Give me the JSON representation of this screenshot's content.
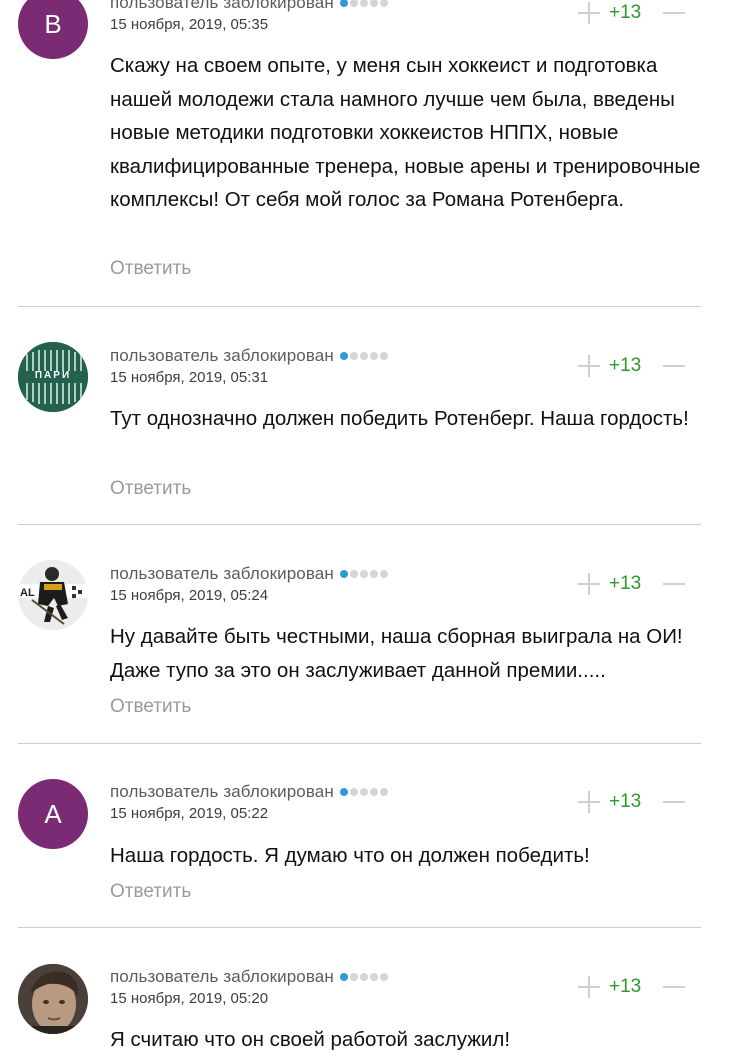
{
  "comments": [
    {
      "avatar_letter": "B",
      "author": "пользователь заблокирован",
      "date": "15 ноября, 2019, 05:35",
      "score": "+13",
      "text": "Скажу на своем опыте, у меня сын хоккеист и подготовка нашей молодежи стала намного лучше чем была, введены новые методики подготовки хоккеистов НППХ, новые квалифицированные тренера, новые арены и тренировочные комплексы! От себя мой голос за Романа Ротенберга.",
      "reply": "Ответить"
    },
    {
      "avatar_logo_text": "ПАРИ",
      "author": "пользователь заблокирован",
      "date": "15 ноября, 2019, 05:31",
      "score": "+13",
      "text": "Тут однозначно должен победить Ротенберг. Наша гордость!",
      "reply": "Ответить"
    },
    {
      "author": "пользователь заблокирован",
      "date": "15 ноября, 2019, 05:24",
      "score": "+13",
      "text": "Ну давайте быть честными, наша сборная выиграла на ОИ! Даже тупо за это он заслуживает данной премии.....",
      "reply": "Ответить"
    },
    {
      "avatar_letter": "A",
      "author": "пользователь заблокирован",
      "date": "15 ноября, 2019, 05:22",
      "score": "+13",
      "text": "Наша гордость. Я думаю что он должен победить!",
      "reply": "Ответить"
    },
    {
      "author": "пользователь заблокирован",
      "date": "15 ноября, 2019, 05:20",
      "score": "+13",
      "text": "Я считаю что он своей работой заслужил!",
      "reply": "Ответить"
    }
  ],
  "user_rating": {
    "filled": 1,
    "total": 5
  },
  "colors": {
    "avatar_letter_bg": "#7b2a74",
    "rating_on": "#2e9bd6",
    "score": "#2c9a2c",
    "reply": "#9a9a9a",
    "divider": "#cdcdcd"
  },
  "icons": [
    "plus-vote-icon",
    "minus-vote-icon"
  ]
}
